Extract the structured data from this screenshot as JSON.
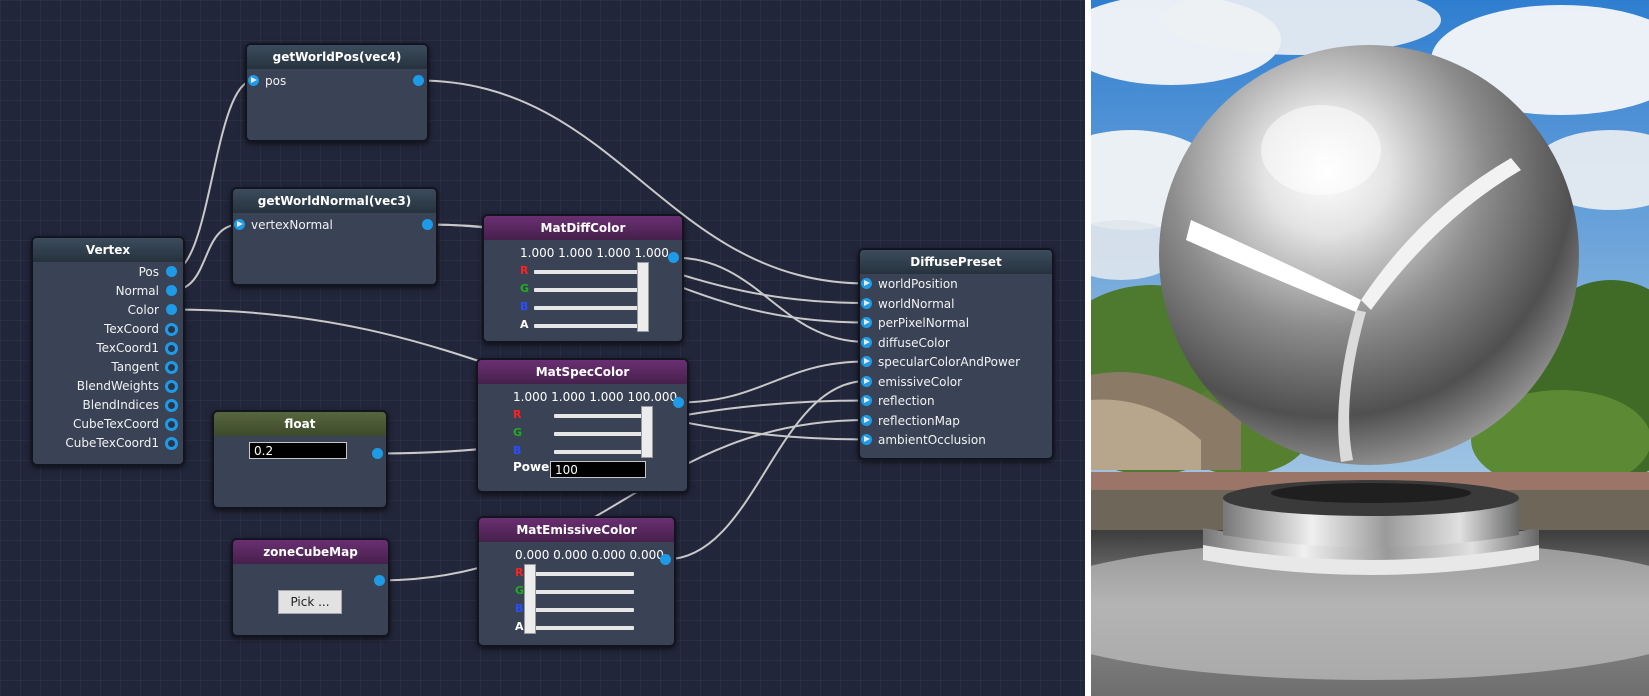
{
  "nodes": {
    "getWorldPos": {
      "title": "getWorldPos(vec4)",
      "input": "pos"
    },
    "getWorldNormal": {
      "title": "getWorldNormal(vec3)",
      "input": "vertexNormal"
    },
    "vertex": {
      "title": "Vertex",
      "outputs": [
        "Pos",
        "Normal",
        "Color",
        "TexCoord",
        "TexCoord1",
        "Tangent",
        "BlendWeights",
        "BlendIndices",
        "CubeTexCoord",
        "CubeTexCoord1"
      ]
    },
    "matDiffColor": {
      "title": "MatDiffColor",
      "value": "1.000 1.000 1.000 1.000",
      "channels": [
        "R",
        "G",
        "B",
        "A"
      ],
      "levels": [
        1.0,
        1.0,
        1.0,
        1.0
      ]
    },
    "matSpecColor": {
      "title": "MatSpecColor",
      "value": "1.000 1.000 1.000 100.000",
      "channels": [
        "R",
        "G",
        "B"
      ],
      "levels": [
        1.0,
        1.0,
        1.0
      ],
      "power_label": "Power",
      "power_value": "100"
    },
    "float": {
      "title": "float",
      "value": "0.2"
    },
    "zoneCubeMap": {
      "title": "zoneCubeMap",
      "button": "Pick ..."
    },
    "matEmissiveColor": {
      "title": "MatEmissiveColor",
      "value": "0.000 0.000 0.000 0.000",
      "channels": [
        "R",
        "G",
        "B",
        "A"
      ],
      "levels": [
        0.0,
        0.0,
        0.0,
        0.0
      ]
    },
    "diffusePreset": {
      "title": "DiffusePreset",
      "inputs": [
        "worldPosition",
        "worldNormal",
        "perPixelNormal",
        "diffuseColor",
        "specularColorAndPower",
        "emissiveColor",
        "reflection",
        "reflectionMap",
        "ambientOcclusion"
      ]
    }
  },
  "colors": {
    "accent_port": "#1e9be6",
    "channel_r": "#ff2020",
    "channel_g": "#1fae1f",
    "channel_b": "#2a4dff",
    "channel_a": "#ffffff",
    "wire": "#c9c9c9",
    "canvas_bg": "#22263a"
  },
  "preview": {
    "scene": "chrome-sphere-on-pedestal",
    "icon": "material-preview-render"
  }
}
